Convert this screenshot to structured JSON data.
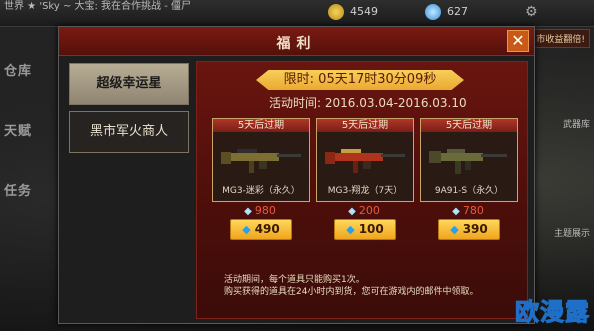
{
  "topbar": {
    "chat_text": "世界 ★ 'Sky ~ 大宝: 我在合作挑战 - 僵尸",
    "currency1": "4549",
    "currency2": "627"
  },
  "left_menu": [
    "仓库",
    "天赋",
    "任务"
  ],
  "right_notices": [
    "市收益翻倍!",
    "武器库",
    "主题展示"
  ],
  "modal": {
    "title": "福利",
    "close_label": "✕",
    "tabs": [
      {
        "label": "超级幸运星",
        "active": true
      },
      {
        "label": "黑市军火商人",
        "active": false
      }
    ],
    "timer": "限时: 05天17时30分09秒",
    "period_label": "活动时间:",
    "period_value": "2016.03.04-2016.03.10",
    "items": [
      {
        "expire": "5天后过期",
        "name": "MG3-迷彩（永久）",
        "old_price": "980",
        "price": "490",
        "gun_color": "#8a7a3a"
      },
      {
        "expire": "5天后过期",
        "name": "MG3-翔龙（7天）",
        "old_price": "200",
        "price": "100",
        "gun_color": "#b23a1e"
      },
      {
        "expire": "5天后过期",
        "name": "9A91-S（永久）",
        "old_price": "780",
        "price": "390",
        "gun_color": "#6a6a3a"
      }
    ],
    "notes": [
      "活动期间，每个道具只能购买1次。",
      "购买获得的道具在24小时内到货，您可在游戏内的邮件中领取。"
    ]
  },
  "watermark": "欧漫露",
  "icons": {
    "diamond": "diamond-icon",
    "close": "close-icon"
  }
}
